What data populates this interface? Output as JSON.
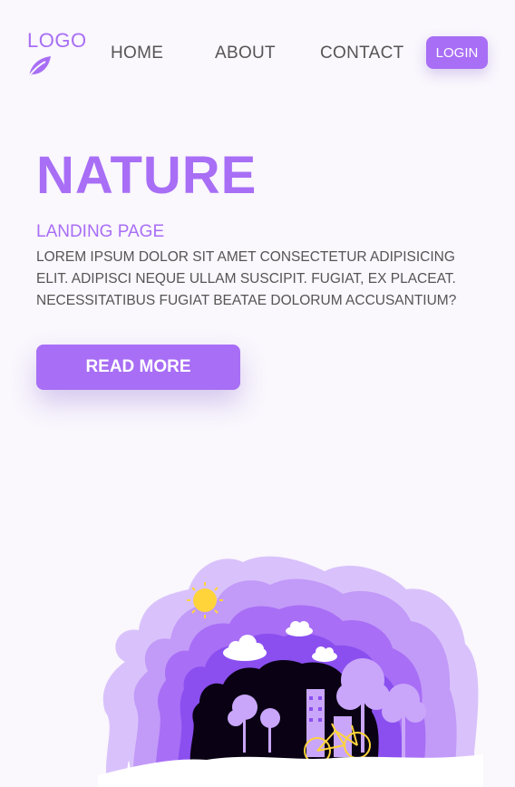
{
  "header": {
    "logo_text": "LOGO",
    "logo_icon": "leaf-icon",
    "nav": [
      {
        "label": "HOME"
      },
      {
        "label": "ABOUT"
      },
      {
        "label": "CONTACT"
      }
    ],
    "login_label": "LOGIN"
  },
  "hero": {
    "title": "NATURE",
    "subtitle": "LANDING PAGE",
    "description": "LOREM IPSUM DOLOR SIT AMET CONSECTETUR ADIPISICING ELIT. ADIPISCI NEQUE ULLAM SUSCIPIT. FUGIAT, EX PLACEAT. NECESSITATIBUS FUGIAT BEATAE DOLORUM ACCUSANTIUM?",
    "button_label": "READ MORE"
  },
  "colors": {
    "accent": "#a86ef5",
    "text": "#555555",
    "background": "#faf7fd"
  }
}
